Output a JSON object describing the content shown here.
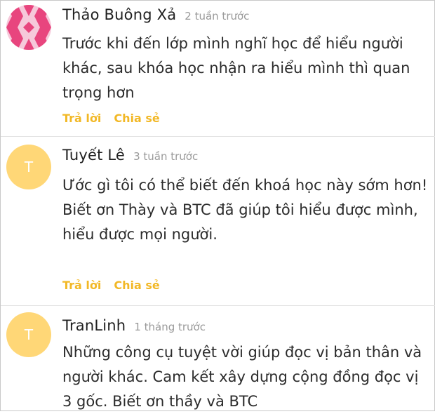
{
  "comments": [
    {
      "author": "Thảo Buông Xả",
      "time": "2 tuần trước",
      "avatar_letter": "",
      "text_lines": [
        "Trước khi đến lớp mình nghĩ học để hiểu người khác, sau khóa học nhận ra hiểu mình thì quan trọng hơn"
      ],
      "reply_label": "Trả lời",
      "share_label": "Chia sẻ"
    },
    {
      "author": "Tuyết Lê",
      "time": "3 tuần trước",
      "avatar_letter": "T",
      "text_lines": [
        "Ước gì tôi có thể biết đến khoá học này sớm hơn!",
        "Biết ơn Thày và BTC đã giúp tôi hiểu được mình, hiểu được mọi người."
      ],
      "reply_label": "Trả lời",
      "share_label": "Chia sẻ"
    },
    {
      "author": "TranLinh",
      "time": "1 tháng trước",
      "avatar_letter": "T",
      "text_lines": [
        "Những công cụ tuyệt vời giúp đọc vị bản thân và người khác. Cam kết xây dựng cộng đồng đọc vị 3 gốc. Biết ơn thầy và BTC"
      ],
      "reply_label": "",
      "share_label": ""
    }
  ],
  "colors": {
    "action": "#f2b826",
    "avatar_letter_bg": "#ffd777",
    "avatar_pattern_pink": "#e8457e",
    "avatar_pattern_light": "#f6c8da"
  },
  "icons": {
    "avatar_1": "pink-diamond-pattern-avatar"
  }
}
